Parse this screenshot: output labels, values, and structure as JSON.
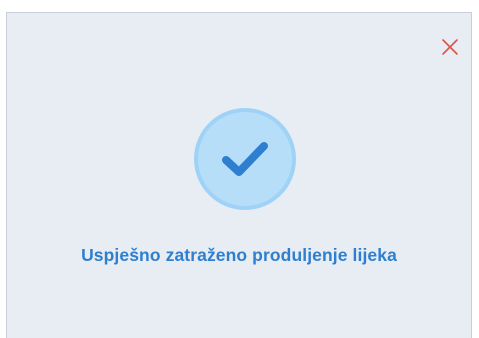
{
  "dialog": {
    "message": "Uspješno zatraženo produljenje lijeka",
    "icons": {
      "close": "close-icon",
      "success": "checkmark-icon"
    },
    "colors": {
      "background": "#e8ecf3",
      "close": "#e0524a",
      "accent": "#2e7fd0",
      "badge": "#b6def9"
    }
  }
}
